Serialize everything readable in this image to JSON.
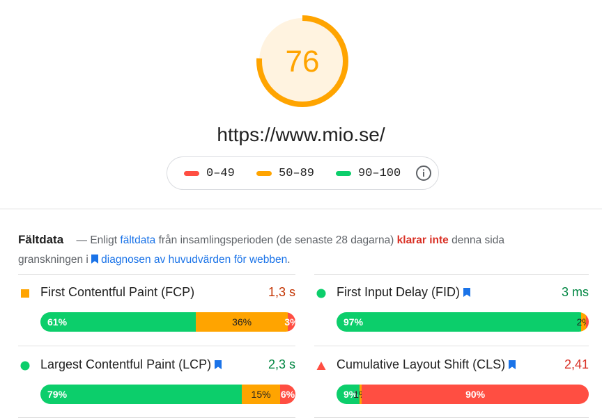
{
  "gauge": {
    "score": "76",
    "fraction": 0.76,
    "color": "#ffa400"
  },
  "url": "https://www.mio.se/",
  "legend": {
    "items": [
      {
        "label": "0–49",
        "color": "#ff4e42"
      },
      {
        "label": "50–89",
        "color": "#ffa400"
      },
      {
        "label": "90–100",
        "color": "#0cce6b"
      }
    ],
    "info_icon": "info-icon"
  },
  "field": {
    "title": "Fältdata",
    "dash": "—",
    "text_1": "Enligt",
    "link_1": "fältdata",
    "text_2": "från insamlingsperioden (de senaste 28 dagarna)",
    "fail_text": "klarar inte",
    "text_3": "denna sida granskningen i",
    "link_2": "diagnosen av huvudvärden för webben",
    "text_4": "."
  },
  "metrics": [
    {
      "name": "First Contentful Paint (FCP)",
      "value": "1,3 s",
      "value_color": "#c33300",
      "status": "average",
      "bar": [
        {
          "label": "61%",
          "pct": 61
        },
        {
          "label": "36%",
          "pct": 36
        },
        {
          "label": "3%",
          "pct": 3
        }
      ]
    },
    {
      "name": "First Input Delay (FID)",
      "value": "3 ms",
      "value_color": "#018642",
      "status": "good",
      "core": true,
      "bar": [
        {
          "label": "97%",
          "pct": 97
        },
        {
          "label": "2%",
          "pct": 2
        },
        {
          "label": "",
          "pct": 1
        }
      ]
    },
    {
      "name": "Largest Contentful Paint (LCP)",
      "value": "2,3 s",
      "value_color": "#018642",
      "status": "good",
      "core": true,
      "bar": [
        {
          "label": "79%",
          "pct": 79
        },
        {
          "label": "15%",
          "pct": 15
        },
        {
          "label": "6%",
          "pct": 6
        }
      ]
    },
    {
      "name": "Cumulative Layout Shift (CLS)",
      "value": "2,41",
      "value_color": "#d93025",
      "status": "poor",
      "core": true,
      "bar": [
        {
          "label": "9%",
          "pct": 9
        },
        {
          "label": "1%",
          "pct": 1
        },
        {
          "label": "90%",
          "pct": 90
        }
      ]
    }
  ]
}
